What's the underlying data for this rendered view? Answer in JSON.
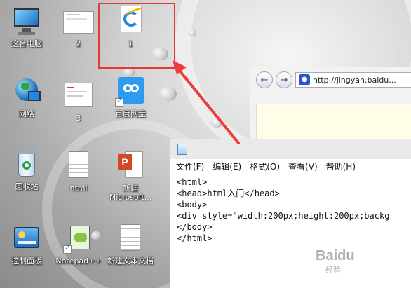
{
  "desktop_icons": [
    {
      "label": "这台电脑"
    },
    {
      "label": "2"
    },
    {
      "label": "1"
    },
    {
      "label": "网络"
    },
    {
      "label": "3"
    },
    {
      "label": "百度网盘"
    },
    {
      "label": "回收站"
    },
    {
      "label": "html"
    },
    {
      "label": "新建 Microsoft..."
    },
    {
      "label": "控制面板"
    },
    {
      "label": "Notepad++"
    },
    {
      "label": "新建文本文档"
    }
  ],
  "browser": {
    "url": "http://jingyan.baidu..."
  },
  "notepad": {
    "menu": [
      "文件(F)",
      "编辑(E)",
      "格式(O)",
      "查看(V)",
      "帮助(H)"
    ],
    "lines": [
      "<html>",
      "<head>html入门</head>",
      "<body>",
      "<div style=\"width:200px;height:200px;backg",
      "</body>",
      "</html>"
    ]
  },
  "watermark": {
    "text": "Baidu",
    "sub": "经验"
  },
  "colors": {
    "highlight": "#e53935",
    "arrow": "#ef3b3b"
  }
}
